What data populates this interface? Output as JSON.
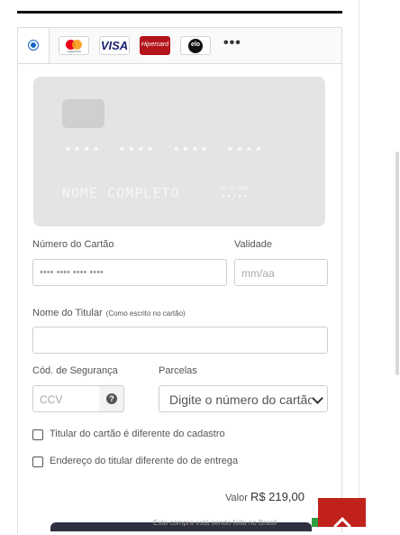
{
  "payment_methods": {
    "brands": [
      "mastercard",
      "VISA",
      "Hipercard",
      "elo"
    ],
    "more_label": "•••"
  },
  "card_preview": {
    "number_mask": "•••• •••• •••• ••••",
    "name_placeholder": "NOME COMPLETO",
    "expiry_caption": "VALID THRU",
    "expiry_mask": "••/••"
  },
  "form": {
    "card_number_label": "Número do Cartão",
    "card_number_placeholder": "•••• •••• •••• ••••",
    "expiry_label": "Validade",
    "expiry_placeholder": "mm/aa",
    "holder_label": "Nome do Titular",
    "holder_hint": "(Como escrito no cartão)",
    "holder_value": "",
    "cvv_label": "Cód. de Segurança",
    "cvv_placeholder": "CCV",
    "installments_label": "Parcelas",
    "installments_selected": "Digite o número do cartão",
    "checkbox_holder_different": "Titular do cartão é diferente do cadastro",
    "checkbox_address_different": "Endereço do titular diferente do de entrega"
  },
  "summary": {
    "valor_label": "Valor",
    "valor_amount": "R$ 219,00",
    "footnote": "Esta compra está sendo feita no Brasil"
  },
  "colors": {
    "accent": "#1565c0",
    "scroll_top_button": "#c0221b"
  }
}
